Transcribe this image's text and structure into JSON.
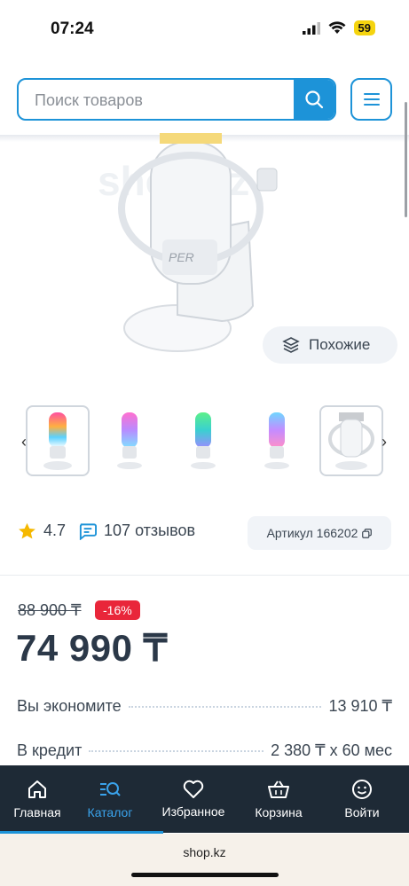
{
  "status": {
    "time": "07:24",
    "battery": "59"
  },
  "search": {
    "placeholder": "Поиск товаров"
  },
  "product": {
    "image_watermark": "shop.kz",
    "similar_label": "Похожие",
    "rating": "4.7",
    "reviews": "107 отзывов",
    "article": "Артикул 166202",
    "old_price": "88 900 ₸",
    "discount": "-16%",
    "price": "74 990 ₸",
    "savings_label": "Вы экономите",
    "savings_value": "13 910 ₸",
    "credit_label": "В кредит",
    "credit_value": "2 380 ₸ x 60 мес"
  },
  "thumbnails": [
    "rgb-white",
    "rgb-pink",
    "rgb-green",
    "rgb-blue",
    "white-mount"
  ],
  "nav": {
    "items": [
      {
        "label": "Главная",
        "icon": "home-icon"
      },
      {
        "label": "Каталог",
        "icon": "catalog-icon",
        "active": true
      },
      {
        "label": "Избранное",
        "icon": "heart-icon"
      },
      {
        "label": "Корзина",
        "icon": "basket-icon"
      },
      {
        "label": "Войти",
        "icon": "smile-icon"
      }
    ]
  },
  "browser": {
    "url": "shop.kz"
  },
  "colors": {
    "accent": "#1d93d8",
    "nav_bg": "#1e2a36",
    "discount": "#e9263a"
  }
}
